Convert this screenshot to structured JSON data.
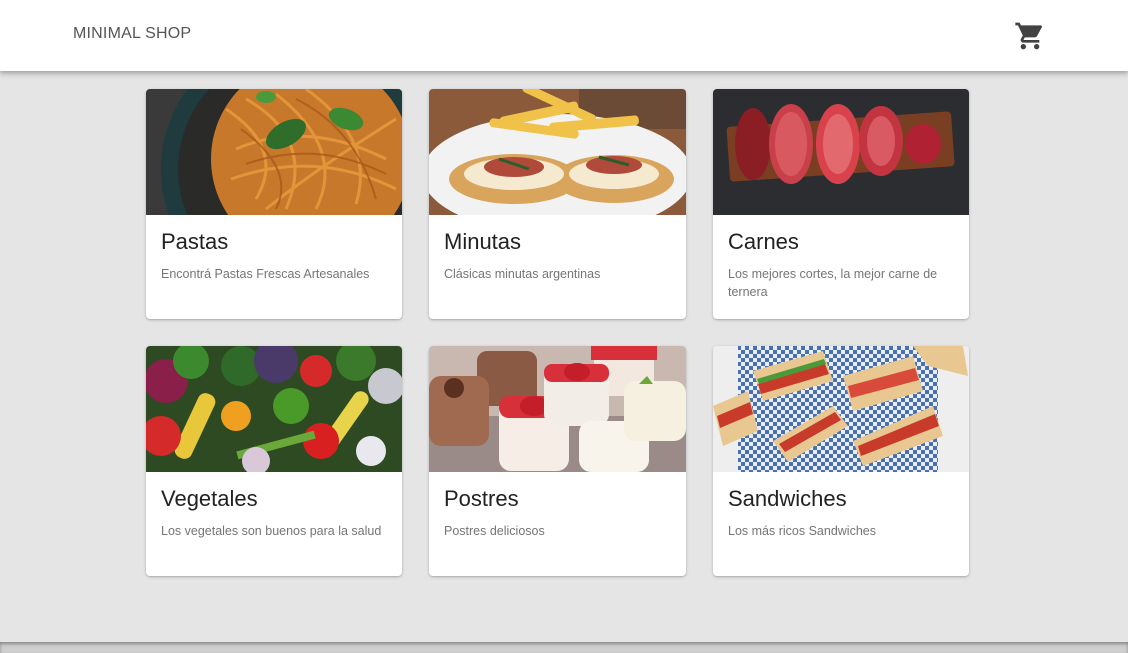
{
  "header": {
    "brand": "MINIMAL SHOP",
    "cart_icon": "shopping-cart-icon"
  },
  "categories": [
    {
      "title": "Pastas",
      "description": "Encontrá Pastas Frescas Artesanales"
    },
    {
      "title": "Minutas",
      "description": "Clásicas minutas argentinas"
    },
    {
      "title": "Carnes",
      "description": "Los mejores cortes, la mejor carne de ternera"
    },
    {
      "title": "Vegetales",
      "description": "Los vegetales son buenos para la salud"
    },
    {
      "title": "Postres",
      "description": "Postres deliciosos"
    },
    {
      "title": "Sandwiches",
      "description": "Los más ricos Sandwiches"
    }
  ],
  "colors": {
    "background": "#e5e5e5",
    "appbar": "#ffffff",
    "title_text": "#222222",
    "description_text": "#757575"
  }
}
